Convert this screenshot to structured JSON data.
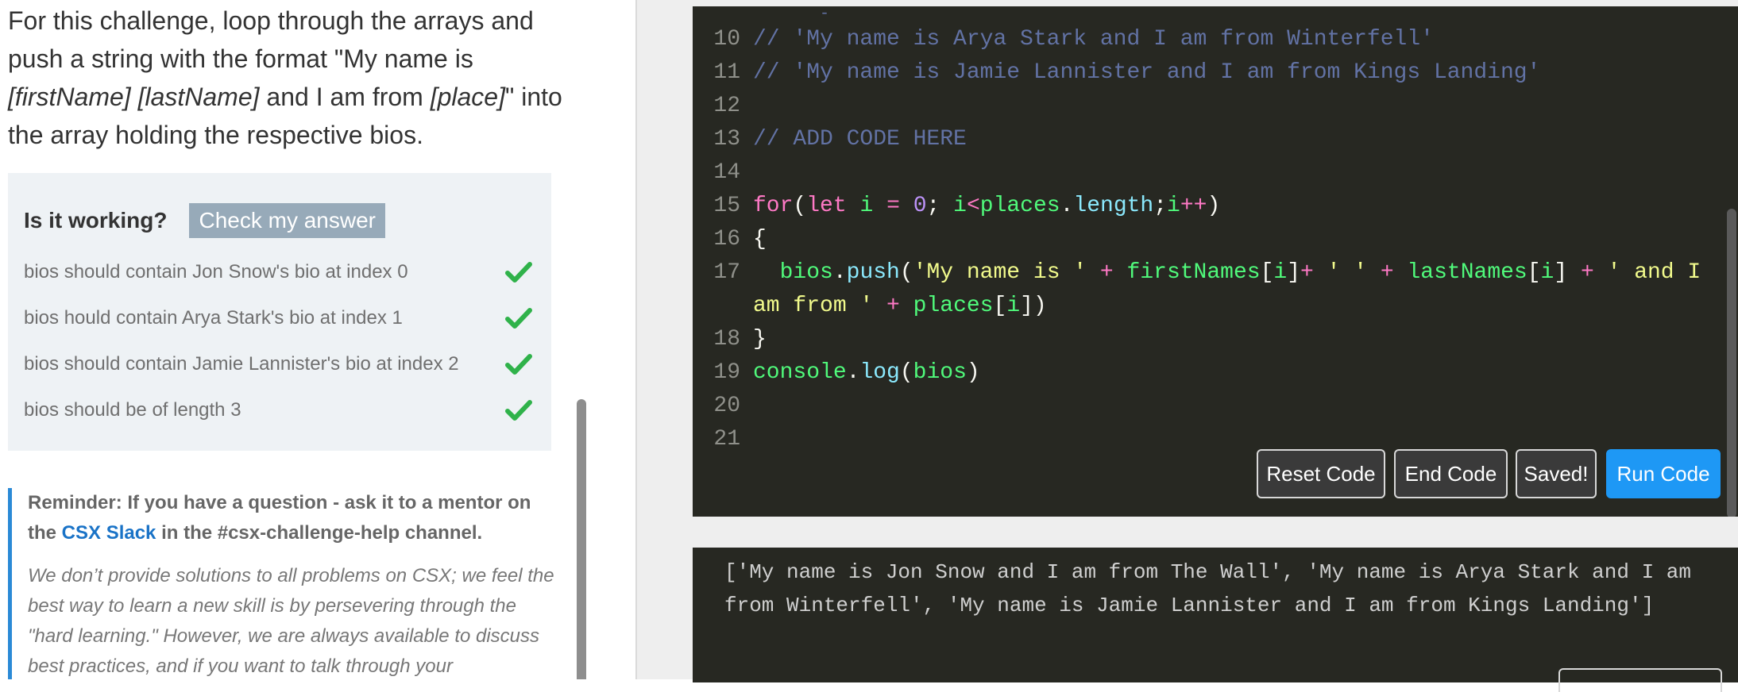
{
  "intro": {
    "line1": "For this challenge, loop through the arrays and",
    "line2": "push a string with the format \"My name is",
    "line3_italic": "[firstName] [lastName]",
    "line3_mid": " and I am from ",
    "line3_italic2": "[place]",
    "line3_end": "\" into",
    "line4": "the array holding the respective bios."
  },
  "tests": {
    "title": "Is it working?",
    "check_button": "Check my answer",
    "items": [
      {
        "label": "bios should contain Jon Snow's bio at index 0",
        "status": "passed"
      },
      {
        "label": "bios hould contain Arya Stark's bio at index 1",
        "status": "passed"
      },
      {
        "label": "bios should contain Jamie Lannister's bio at index 2",
        "status": "passed"
      },
      {
        "label": "bios should be of length 3",
        "status": "passed"
      }
    ]
  },
  "reminder": {
    "prefix": "Reminder: If you have a question - ask it to a mentor on the ",
    "link": "CSX Slack",
    "suffix": " in the #csx-challenge-help channel.",
    "note": "We don’t provide solutions to all problems on CSX; we feel the best way to learn a new skill is by persevering through the \"hard learning.\" However, we are always available to discuss best practices, and if you want to talk through your"
  },
  "editor": {
    "lines": {
      "n10": "10",
      "c10": "// 'My name is Arya Stark and I am from Winterfell'",
      "n11": "11",
      "c11": "// 'My name is Jamie Lannister and I am from Kings Landing'",
      "n12": "12",
      "n13": "13",
      "c13": "// ADD CODE HERE",
      "n14": "14",
      "n15": "15",
      "n16": "16",
      "n17": "17",
      "n18": "18",
      "n19": "19",
      "n20": "20",
      "n21": "21"
    },
    "buttons": {
      "reset": "Reset Code",
      "end": "End Code",
      "saved": "Saved!",
      "run": "Run Code"
    }
  },
  "console": {
    "output": "['My name is Jon Snow and I am from The Wall', 'My name is Arya Stark and I am from Winterfell', 'My name is Jamie Lannister and I am from Kings Landing']"
  },
  "colors": {
    "pass": "#2fb24a",
    "run_button": "#1e98f5",
    "check_button": "#97aab9",
    "link": "#1a73c7",
    "editor_bg": "#272822"
  },
  "icons": {
    "test_status": "checkmark-icon"
  }
}
